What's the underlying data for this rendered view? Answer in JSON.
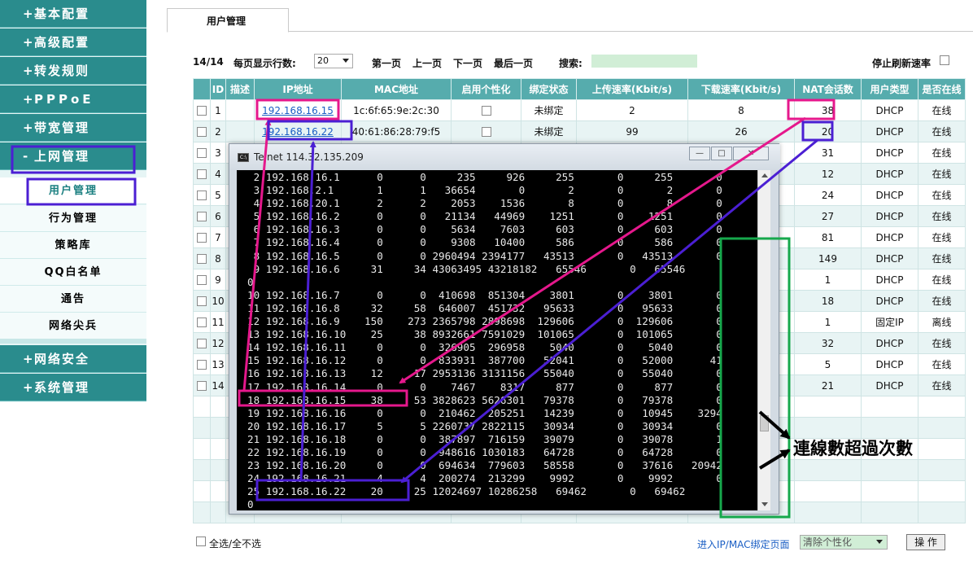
{
  "sidebar": {
    "main_items": [
      {
        "prefix": "+",
        "label": "基本配置"
      },
      {
        "prefix": "+",
        "label": "高级配置"
      },
      {
        "prefix": "+",
        "label": "转发规则"
      },
      {
        "prefix": "+",
        "label": "PPPoE"
      },
      {
        "prefix": "+",
        "label": "带宽管理"
      },
      {
        "prefix": "-",
        "label": "上网管理"
      }
    ],
    "sub_items": [
      "用户管理",
      "行为管理",
      "策略库",
      "QQ白名单",
      "通告",
      "网络尖兵"
    ],
    "bottom_items": [
      {
        "prefix": "+",
        "label": "网络安全"
      },
      {
        "prefix": "+",
        "label": "系统管理"
      }
    ]
  },
  "tab": {
    "label": "用户管理"
  },
  "toolbar": {
    "page_info": "14/14",
    "rows_label": "每页显示行数:",
    "rows_value": "20",
    "first": "第一页",
    "prev": "上一页",
    "next": "下一页",
    "last": "最后一页",
    "search_label": "搜索:",
    "stop_refresh": "停止刷新速率"
  },
  "table": {
    "headers": [
      "ID",
      "描述",
      "IP地址",
      "MAC地址",
      "启用个性化",
      "绑定状态",
      "上传速率(Kbit/s)",
      "下载速率(Kbit/s)",
      "NAT会话数",
      "用户类型",
      "是否在线"
    ],
    "rows": [
      {
        "id": "1",
        "ip": "192.168.16.15",
        "mac": "1c:6f:65:9e:2c:30",
        "bind": "未绑定",
        "up": "2",
        "down": "8",
        "nat": "38",
        "type": "DHCP",
        "online": "在线"
      },
      {
        "id": "2",
        "ip": "192.168.16.22",
        "mac": "40:61:86:28:79:f5",
        "bind": "未绑定",
        "up": "99",
        "down": "26",
        "nat": "20",
        "type": "DHCP",
        "online": "在线"
      },
      {
        "id": "3",
        "nat": "31",
        "type": "DHCP",
        "online": "在线"
      },
      {
        "id": "4",
        "nat": "12",
        "type": "DHCP",
        "online": "在线"
      },
      {
        "id": "5",
        "nat": "24",
        "type": "DHCP",
        "online": "在线"
      },
      {
        "id": "6",
        "nat": "27",
        "type": "DHCP",
        "online": "在线"
      },
      {
        "id": "7",
        "nat": "81",
        "type": "DHCP",
        "online": "在线"
      },
      {
        "id": "8",
        "nat": "149",
        "type": "DHCP",
        "online": "在线"
      },
      {
        "id": "9",
        "nat": "1",
        "type": "DHCP",
        "online": "在线"
      },
      {
        "id": "10",
        "nat": "18",
        "type": "DHCP",
        "online": "在线"
      },
      {
        "id": "11",
        "nat": "1",
        "type": "固定IP",
        "online": "离线"
      },
      {
        "id": "12",
        "nat": "32",
        "type": "DHCP",
        "online": "在线"
      },
      {
        "id": "13",
        "nat": "5",
        "type": "DHCP",
        "online": "在线"
      },
      {
        "id": "14",
        "nat": "21",
        "type": "DHCP",
        "online": "在线"
      }
    ]
  },
  "footer": {
    "select_all": "全选/全不选",
    "bind_link": "进入IP/MAC绑定页面",
    "clear_select": "清除个性化",
    "op_button": "操 作"
  },
  "telnet": {
    "title": "Telnet 114.32.135.209",
    "win_min": "—",
    "win_max": "□",
    "win_close": "✕",
    "lines": [
      " 2 192.168.16.1      0      0     235     926     255       0     255       0",
      " 3 192.168.2.1       1      1   36654       0       2       0       2       0",
      " 4 192.168.20.1      2      2    2053    1536       8       0       8       0",
      " 5 192.168.16.2      0      0   21134   44969    1251       0    1251       0",
      " 6 192.168.16.3      0      0    5634    7603     603       0     603       0",
      " 7 192.168.16.4      0      0    9308   10400     586       0     586       0",
      " 8 192.168.16.5      0      0 2960494 2394177   43513       0   43513       0",
      " 9 192.168.16.6     31     34 43063495 43218182   65546       0   65546",
      "0",
      "10 192.168.16.7      0      0  410698  851304    3801       0    3801       0",
      "11 192.168.16.8     32     58  646007  451732   95633       0   95633       0",
      "12 192.168.16.9    150    273 2365798 2898698  129606       0  129606       0",
      "13 192.168.16.10    25     38 8932661 7591029  101065       0  101065       0",
      "14 192.168.16.11     0      0  326905  296958    5040       0    5040       0",
      "15 192.168.16.12     0      0  833931  387700   52041       0   52000      41",
      "16 192.168.16.13    12     17 2953136 3131156   55040       0   55040       0",
      "17 192.168.16.14     0      0    7467    8317     877       0     877       0",
      "18 192.168.16.15    38     53 3828623 5626301   79378       0   79378       0",
      "19 192.168.16.16     0      0  210462  205251   14239       0   10945    3294",
      "20 192.168.16.17     5      5 2260737 2822115   30934       0   30934       0",
      "21 192.168.16.18     0      0  387897  716159   39079       0   39078       1",
      "22 192.168.16.19     0      0  948616 1030183   64728       0   64728       0",
      "23 192.168.16.20     0      0  694634  779603   58558       0   37616   20942",
      "24 192.168.16.21     4      4  200274  213299    9992       0    9992       0",
      "25 192.168.16.22    20     25 12024697 10286258   69462       0   69462",
      "0"
    ]
  },
  "annotation": {
    "text": "連線數超過次數"
  },
  "colors": {
    "pink": "#e5188c",
    "purple": "#4b1fd3",
    "green": "#16a84c",
    "teal": "#2a8c8d"
  }
}
